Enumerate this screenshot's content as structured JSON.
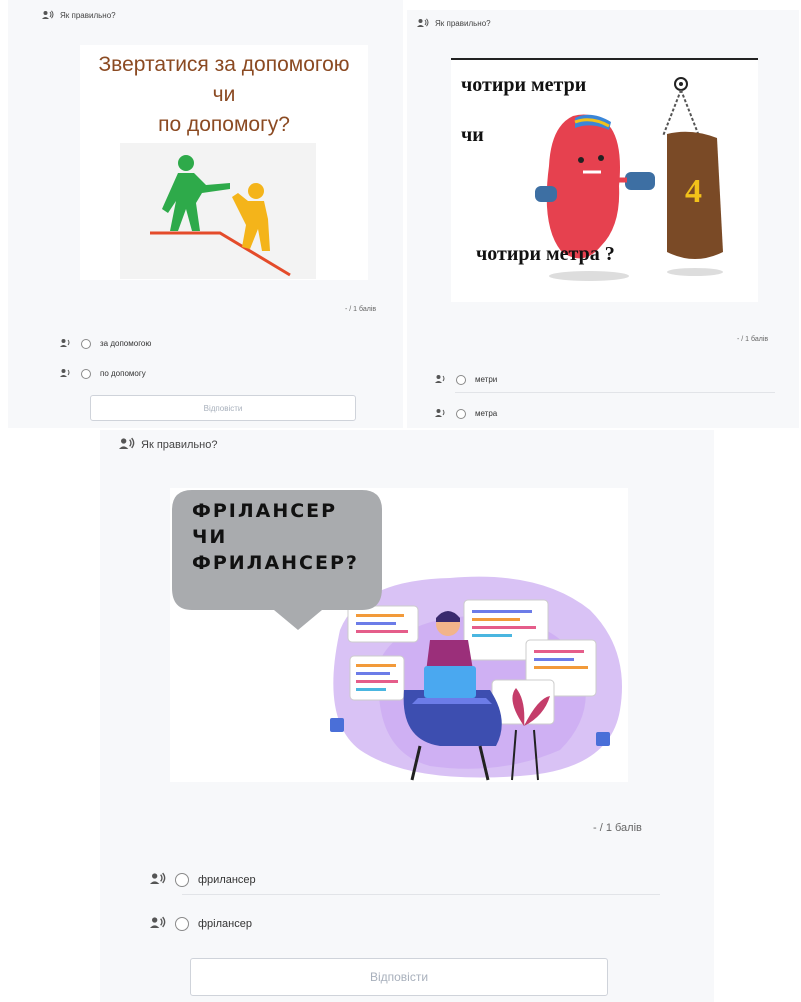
{
  "q1": {
    "prompt": "Як правильно?",
    "image_text": {
      "line1": "Звертатися за допомогою",
      "line2": "чи",
      "line3": "по допомогу?"
    },
    "score": "- / 1 балів",
    "options": [
      "за допомогою",
      "по допомогу"
    ],
    "answer_label": "Відповісти"
  },
  "q2": {
    "prompt": "Як правильно?",
    "image_text": {
      "line1": "чотири метри",
      "line2": "чи",
      "line3": "чотири метра ?",
      "bag_number": "4"
    },
    "score": "- / 1 балів",
    "options": [
      "метри",
      "метра"
    ]
  },
  "q3": {
    "prompt": "Як правильно?",
    "image_text": {
      "line1": "ФРІЛАНСЕР",
      "line2": "ЧИ",
      "line3": "ФРИЛАНСЕР?"
    },
    "score": "- / 1 балів",
    "options": [
      "фрилансер",
      "фрілансер"
    ],
    "answer_label": "Відповісти"
  },
  "colors": {
    "card_bg": "#f7f8fa",
    "q1_title": "#8b4a22",
    "accent_purple": "#c9b0f0"
  }
}
